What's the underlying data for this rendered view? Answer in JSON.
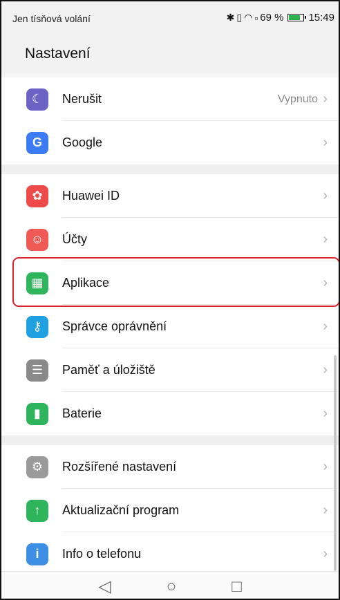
{
  "status_bar": {
    "carrier_text": "Jen tísňová volání",
    "battery_text": "69 %",
    "time": "15:49",
    "icons": [
      "bluetooth-icon",
      "vibrate-icon",
      "wifi-icon",
      "sim-icon",
      "battery-icon"
    ]
  },
  "header": {
    "title": "Nastavení"
  },
  "settings": {
    "groups": [
      {
        "items": [
          {
            "label": "Nerušit",
            "value": "Vypnuto",
            "icon": "moon-icon",
            "color": "#6c63c7",
            "glyph": "☾"
          },
          {
            "label": "Google",
            "value": "",
            "icon": "google-icon",
            "color": "#3b7cf4",
            "glyph": "G"
          }
        ]
      },
      {
        "items": [
          {
            "label": "Huawei ID",
            "value": "",
            "icon": "huawei-icon",
            "color": "#ef4a4a",
            "glyph": "✿"
          },
          {
            "label": "Účty",
            "value": "",
            "icon": "account-icon",
            "color": "#ef5a55",
            "glyph": "☺"
          },
          {
            "label": "Aplikace",
            "value": "",
            "icon": "apps-icon",
            "color": "#2fb55b",
            "glyph": "▦",
            "highlighted": true
          },
          {
            "label": "Správce oprávnění",
            "value": "",
            "icon": "key-icon",
            "color": "#1fa0e0",
            "glyph": "⚷"
          },
          {
            "label": "Paměť a úložiště",
            "value": "",
            "icon": "storage-icon",
            "color": "#8a8a8a",
            "glyph": "☰"
          },
          {
            "label": "Baterie",
            "value": "",
            "icon": "battery-setting-icon",
            "color": "#2eb45a",
            "glyph": "▮"
          }
        ]
      },
      {
        "items": [
          {
            "label": "Rozšířené nastavení",
            "value": "",
            "icon": "advanced-settings-icon",
            "color": "#9a9a9a",
            "glyph": "⚙"
          },
          {
            "label": "Aktualizační program",
            "value": "",
            "icon": "update-icon",
            "color": "#2eb45a",
            "glyph": "↑"
          },
          {
            "label": "Info o telefonu",
            "value": "",
            "icon": "info-icon",
            "color": "#3d8fe6",
            "glyph": "i"
          }
        ]
      }
    ]
  },
  "nav_bar": {
    "back": "◁",
    "home": "○",
    "recents": "□"
  }
}
